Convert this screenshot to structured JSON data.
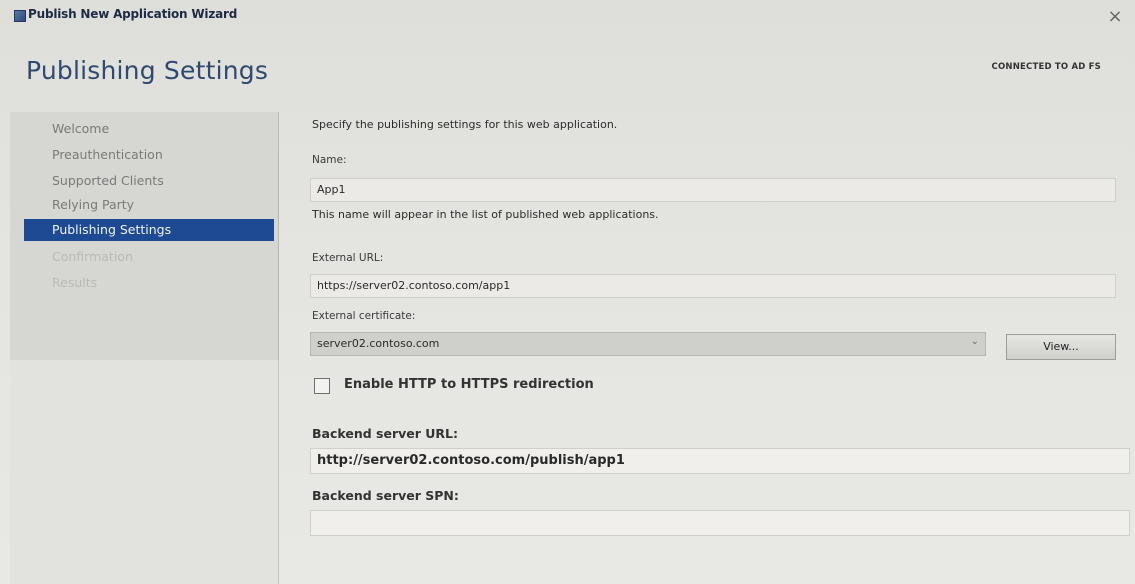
{
  "window": {
    "title": "Publish New Application Wizard",
    "close_glyph": "×"
  },
  "header": {
    "title": "Publishing Settings",
    "connection_status": "CONNECTED TO AD FS"
  },
  "nav": {
    "items": [
      {
        "label": "Welcome",
        "state": "normal"
      },
      {
        "label": "Preauthentication",
        "state": "normal"
      },
      {
        "label": "Supported Clients",
        "state": "normal"
      },
      {
        "label": "Relying Party",
        "state": "normal"
      },
      {
        "label": "Publishing Settings",
        "state": "active"
      },
      {
        "label": "Confirmation",
        "state": "disabled"
      },
      {
        "label": "Results",
        "state": "disabled"
      }
    ]
  },
  "content": {
    "intro": "Specify the publishing settings for this web application.",
    "name": {
      "label": "Name:",
      "value": "App1",
      "hint": "This name will appear in the list of published web applications."
    },
    "external_url": {
      "label": "External URL:",
      "value": "https://server02.contoso.com/app1"
    },
    "external_certificate": {
      "label": "External certificate:",
      "value": "server02.contoso.com",
      "arrow": "⌄",
      "view_button": "View..."
    },
    "redirect": {
      "label": "Enable HTTP to HTTPS redirection",
      "checked": false
    },
    "backend_url": {
      "label": "Backend server URL:",
      "value": "http://server02.contoso.com/publish/app1"
    },
    "backend_spn": {
      "label": "Backend server SPN:",
      "value": ""
    }
  },
  "colors": {
    "accent": "#1d4a93",
    "title": "#2f4a6e"
  }
}
